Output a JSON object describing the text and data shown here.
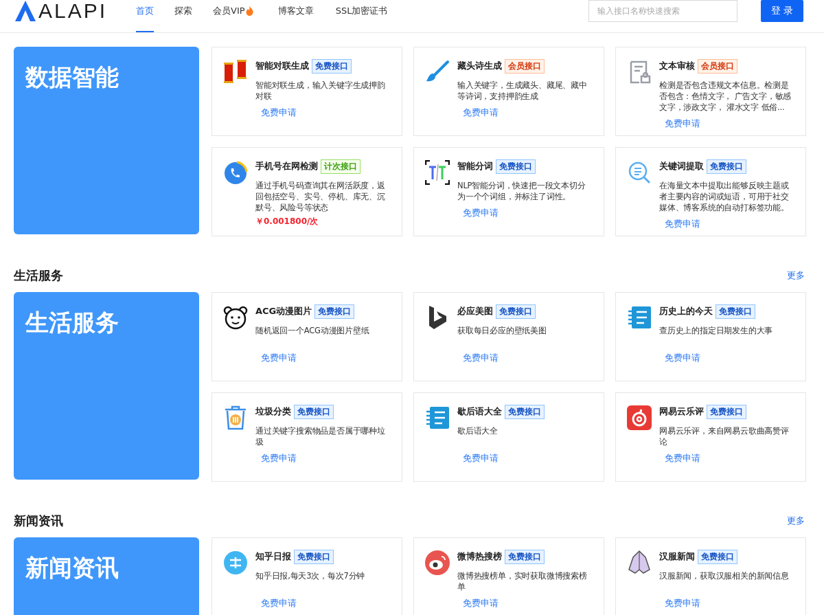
{
  "header": {
    "logo": "ALAPI",
    "nav": [
      {
        "label": "首页",
        "selected": true,
        "flame": false
      },
      {
        "label": "探索",
        "selected": false,
        "flame": false
      },
      {
        "label": "会员VIP",
        "selected": false,
        "flame": true
      },
      {
        "label": "博客文章",
        "selected": false,
        "flame": false
      },
      {
        "label": "SSL加密证书",
        "selected": false,
        "flame": false
      }
    ],
    "search": {
      "placeholder": "输入接口名称快速搜索"
    },
    "login": "登 录"
  },
  "sections": [
    {
      "banner": "数据智能",
      "cards": [
        {
          "kind": "scroll",
          "title": "智能对联生成",
          "badge": {
            "kind": "free",
            "label": "免费接口"
          },
          "desc": "智能对联生成，输入关键字生成押韵对联",
          "action": {
            "kind": "link",
            "label": "免费申请"
          }
        },
        {
          "kind": "brush",
          "title": "藏头诗生成",
          "badge": {
            "kind": "member",
            "label": "会员接口"
          },
          "desc": "输入关键字，生成藏头、藏尾、藏中等诗词，支持押韵生成",
          "action": {
            "kind": "link",
            "label": "免费申请"
          }
        },
        {
          "kind": "document",
          "title": "文本审核",
          "badge": {
            "kind": "member",
            "label": "会员接口"
          },
          "desc": "检测是否包含违规文本信息。检测是否包含：色情文字， 广告文字，敏感文字，涉政文字， 灌水文字 低俗...",
          "action": {
            "kind": "link",
            "label": "免费申请"
          }
        },
        {
          "kind": "phone",
          "title": "手机号在网检测",
          "badge": {
            "kind": "metered",
            "label": "计次接口"
          },
          "desc": "通过手机号码查询其在网活跃度，返回包括空号、实号、停机、库无、沉默号、风险号等状态",
          "action": {
            "kind": "price",
            "label": "￥0.001800/次"
          }
        },
        {
          "kind": "split",
          "title": "智能分词",
          "badge": {
            "kind": "free",
            "label": "免费接口"
          },
          "desc": "NLP智能分词，快速把一段文本切分为一个个词组，并标注了词性。",
          "action": {
            "kind": "link",
            "label": "免费申请"
          }
        },
        {
          "kind": "magnifier",
          "title": "关键词提取",
          "badge": {
            "kind": "free",
            "label": "免费接口"
          },
          "desc": "在海量文本中提取出能够反映主题或者主要内容的词或短语，可用于社交媒体、博客系统的自动打标签功能。",
          "action": {
            "kind": "link",
            "label": "免费申请"
          }
        }
      ]
    },
    {
      "title": "生活服务",
      "more": "更多",
      "banner": "生活服务",
      "cards": [
        {
          "kind": "bear",
          "title": "ACG动漫图片",
          "badge": {
            "kind": "free",
            "label": "免费接口"
          },
          "desc": "随机返回一个ACG动漫图片壁纸",
          "action": {
            "kind": "link",
            "label": "免费申请"
          }
        },
        {
          "kind": "bing",
          "title": "必应美图",
          "badge": {
            "kind": "free",
            "label": "免费接口"
          },
          "desc": "获取每日必应的壁纸美图",
          "action": {
            "kind": "link",
            "label": "免费申请"
          }
        },
        {
          "kind": "notebook",
          "title": "历史上的今天",
          "badge": {
            "kind": "free",
            "label": "免费接口"
          },
          "desc": "查历史上的指定日期发生的大事",
          "action": {
            "kind": "link",
            "label": "免费申请"
          }
        },
        {
          "kind": "trash",
          "title": "垃圾分类",
          "badge": {
            "kind": "free",
            "label": "免费接口"
          },
          "desc": "通过关键字搜索物品是否属于哪种垃圾",
          "action": {
            "kind": "link",
            "label": "免费申请"
          }
        },
        {
          "kind": "notebook",
          "title": "歇后语大全",
          "badge": {
            "kind": "free",
            "label": "免费接口"
          },
          "desc": "歇后语大全",
          "action": {
            "kind": "link",
            "label": "免费申请"
          }
        },
        {
          "kind": "music",
          "title": "网易云乐评",
          "badge": {
            "kind": "free",
            "label": "免费接口"
          },
          "desc": "网易云乐评，来自网易云歌曲高赞评论",
          "action": {
            "kind": "link",
            "label": "免费申请"
          }
        }
      ]
    },
    {
      "title": "新闻资讯",
      "more": "更多",
      "banner": "新闻资讯",
      "cards": [
        {
          "kind": "circle",
          "title": "知乎日报",
          "badge": {
            "kind": "free",
            "label": "免费接口"
          },
          "desc": "知乎日报,每天3次，每次7分钟",
          "action": {
            "kind": "link",
            "label": "免费申请"
          }
        },
        {
          "kind": "eye",
          "title": "微博热搜榜",
          "badge": {
            "kind": "free",
            "label": "免费接口"
          },
          "desc": "微博热搜榜单，实时获取微博搜索榜单",
          "action": {
            "kind": "link",
            "label": "免费申请"
          }
        },
        {
          "kind": "robe",
          "title": "汉服新闻",
          "badge": {
            "kind": "free",
            "label": "免费接口"
          },
          "desc": "汉服新闻，获取汉服相关的新闻信息",
          "action": {
            "kind": "link",
            "label": "免费申请"
          }
        }
      ]
    }
  ]
}
